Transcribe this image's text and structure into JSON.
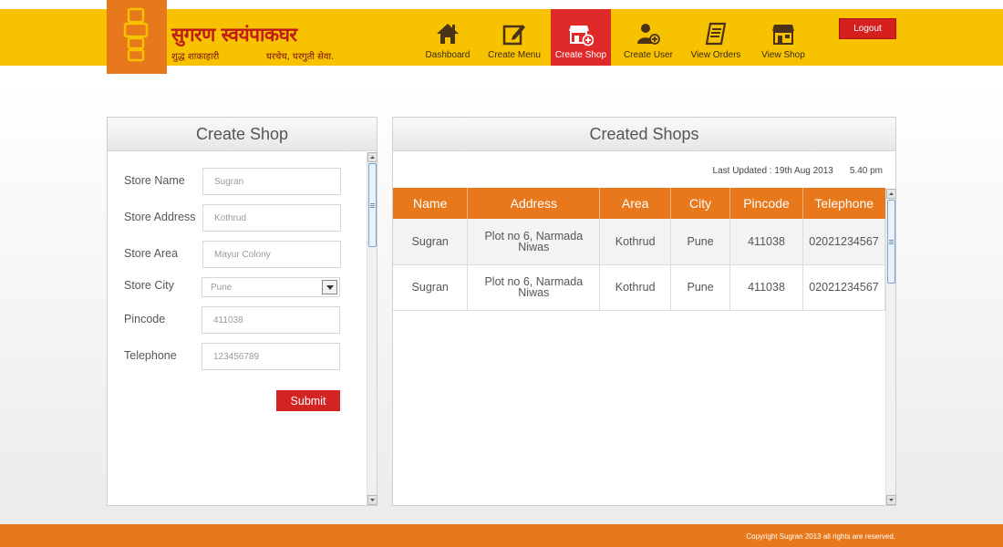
{
  "brand": {
    "title": "सुगरण स्वयंपाकघर",
    "sub1": "शुद्ध शाकाहारी",
    "sub2": "घरचेच, घरगुती सेवा."
  },
  "nav": [
    {
      "label": "Dashboard",
      "icon": "home-icon"
    },
    {
      "label": "Create Menu",
      "icon": "edit-icon"
    },
    {
      "label": "Create Shop",
      "icon": "shop-add-icon",
      "active": true
    },
    {
      "label": "Create User",
      "icon": "user-add-icon"
    },
    {
      "label": "View Orders",
      "icon": "orders-icon"
    },
    {
      "label": "View Shop",
      "icon": "shop-icon"
    }
  ],
  "logout_label": "Logout",
  "create_shop": {
    "title": "Create Shop",
    "fields": {
      "store_name": {
        "label": "Store Name",
        "value": "Sugran"
      },
      "store_address": {
        "label": "Store Address",
        "value": "Kothrud"
      },
      "store_area": {
        "label": "Store Area",
        "value": "Mayur Colony"
      },
      "store_city": {
        "label": "Store City",
        "value": "Pune"
      },
      "pincode": {
        "label": "Pincode",
        "value": "411038"
      },
      "telephone": {
        "label": "Telephone",
        "value": "123456789"
      }
    },
    "submit_label": "Submit"
  },
  "created_shops": {
    "title": "Created Shops",
    "last_updated_label": "Last Updated : 19th Aug 2013",
    "last_updated_time": "5.40 pm",
    "columns": [
      "Name",
      "Address",
      "Area",
      "City",
      "Pincode",
      "Telephone"
    ],
    "rows": [
      [
        "Sugran",
        "Plot no 6, Narmada\nNiwas",
        "Kothrud",
        "Pune",
        "411038",
        "02021234567"
      ],
      [
        "Sugran",
        "Plot no 6, Narmada\nNiwas",
        "Kothrud",
        "Pune",
        "411038",
        "02021234567"
      ]
    ]
  },
  "footer": {
    "copyright": "Copyright Sugran 2013 all rights are reserved."
  },
  "colors": {
    "header": "#f7c200",
    "accent": "#e8781c",
    "active": "#e02a2a",
    "button": "#d42323"
  }
}
